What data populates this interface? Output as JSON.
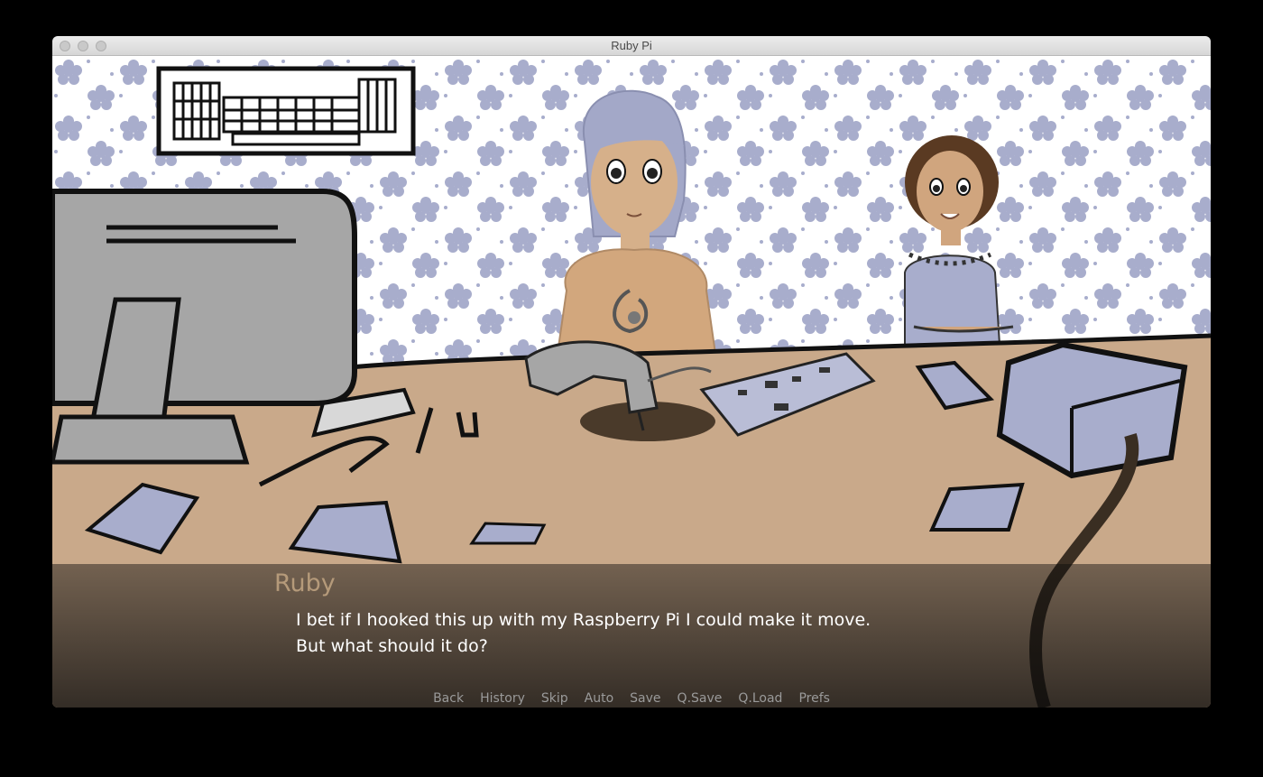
{
  "window": {
    "title": "Ruby Pi"
  },
  "dialogue": {
    "speaker": "Ruby",
    "lines": [
      "I bet if I hooked this up with my Raspberry Pi I could make it move.",
      "But what should it do?"
    ]
  },
  "quick_menu": {
    "items": [
      "Back",
      "History",
      "Skip",
      "Auto",
      "Save",
      "Q.Save",
      "Q.Load",
      "Prefs"
    ]
  },
  "colors": {
    "wallpaper_bg": "#ffffff",
    "flower": "#a8adcc",
    "desk": "#c9a98a",
    "speaker_name": "#b59a7a",
    "menu_text": "#9a9a9a"
  }
}
